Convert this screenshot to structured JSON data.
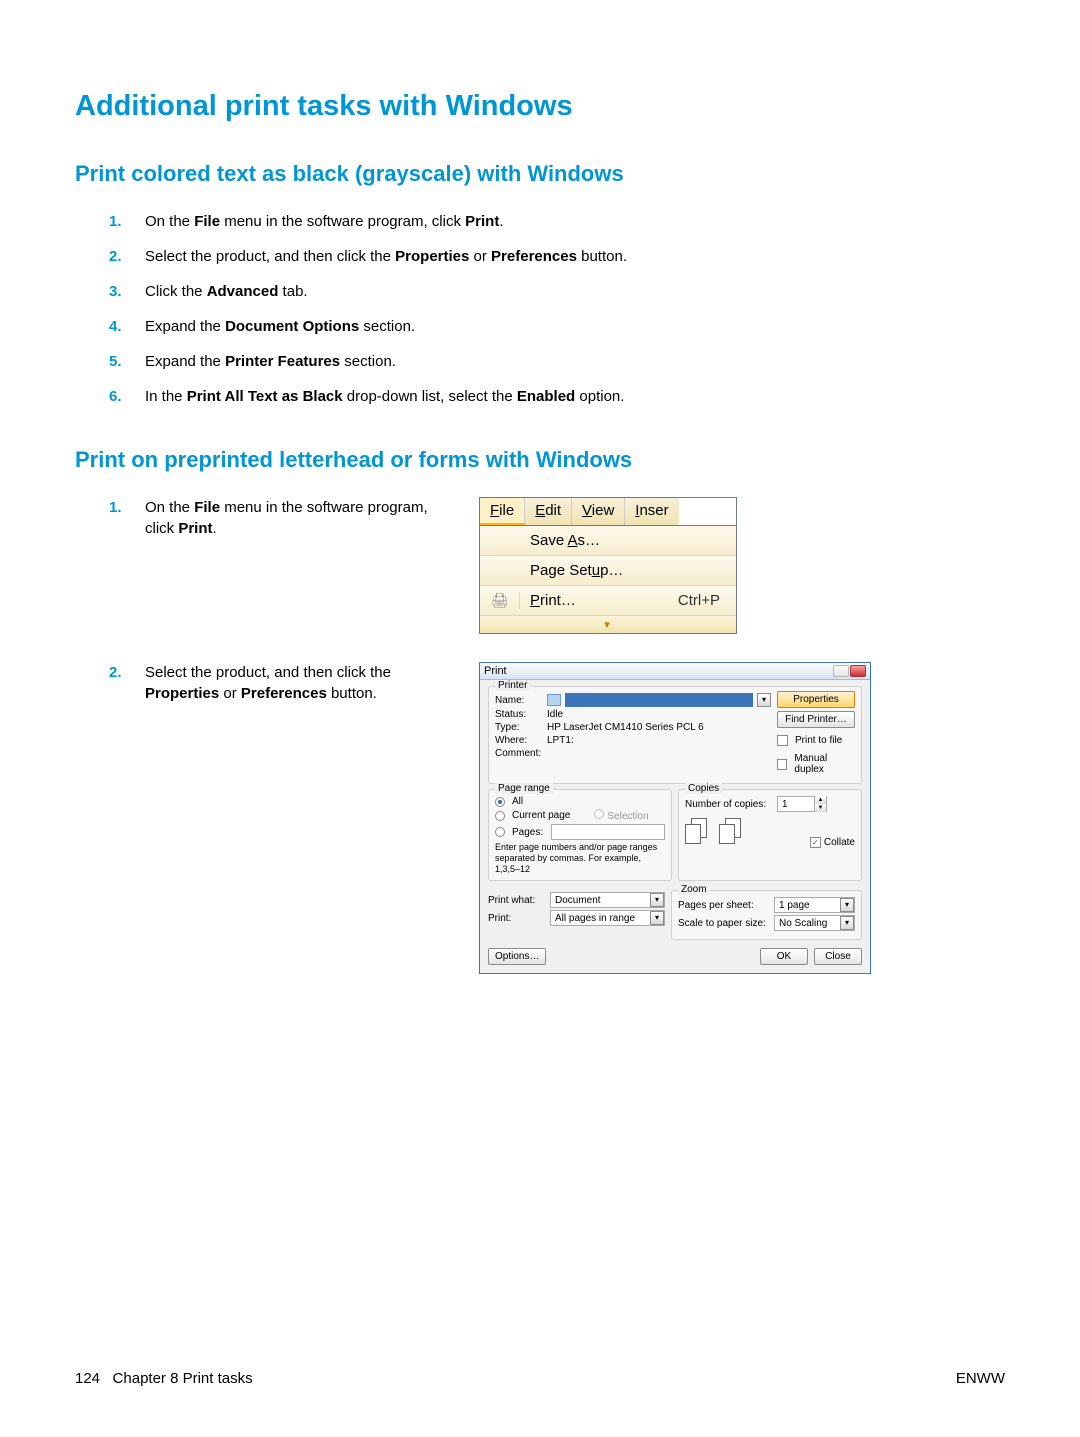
{
  "heading1": "Additional print tasks with Windows",
  "section1": {
    "title": "Print colored text as black (grayscale) with Windows",
    "steps": [
      {
        "pre": "On the ",
        "b1": "File",
        "mid": " menu in the software program, click ",
        "b2": "Print",
        "post": "."
      },
      {
        "pre": "Select the product, and then click the ",
        "b1": "Properties",
        "mid": " or ",
        "b2": "Preferences",
        "post": " button."
      },
      {
        "pre": "Click the ",
        "b1": "Advanced",
        "mid": "",
        "b2": "",
        "post": " tab."
      },
      {
        "pre": "Expand the ",
        "b1": "Document Options",
        "mid": "",
        "b2": "",
        "post": " section."
      },
      {
        "pre": "Expand the ",
        "b1": "Printer Features",
        "mid": "",
        "b2": "",
        "post": " section."
      },
      {
        "pre": "In the ",
        "b1": "Print All Text as Black",
        "mid": " drop-down list, select the ",
        "b2": "Enabled",
        "post": " option."
      }
    ]
  },
  "section2": {
    "title": "Print on preprinted letterhead or forms with Windows",
    "step1": {
      "pre": "On the ",
      "b1": "File",
      "mid": " menu in the software program, click ",
      "b2": "Print",
      "post": "."
    },
    "step2": {
      "pre": "Select the product, and then click the ",
      "b1": "Properties",
      "mid": " or ",
      "b2": "Preferences",
      "post": " button."
    }
  },
  "menu": {
    "file": "File",
    "edit": "Edit",
    "view": "View",
    "insert": "Inser",
    "items": {
      "saveas": "Save As…",
      "pagesetup": "Page Setup…",
      "print": "Print…",
      "print_sc": "Ctrl+P"
    }
  },
  "print_dialog": {
    "title": "Print",
    "printer_grp": "Printer",
    "name": "Name:",
    "status_lbl": "Status:",
    "status_val": "Idle",
    "type_lbl": "Type:",
    "type_val": "HP LaserJet CM1410 Series PCL 6",
    "where_lbl": "Where:",
    "where_val": "LPT1:",
    "comment_lbl": "Comment:",
    "properties_btn": "Properties",
    "find_btn": "Find Printer…",
    "print_to_file": "Print to file",
    "manual_duplex": "Manual duplex",
    "pagerange_grp": "Page range",
    "all": "All",
    "current": "Current page",
    "selection": "Selection",
    "pages": "Pages:",
    "pages_hint": "Enter page numbers and/or page ranges separated by commas. For example, 1,3,5–12",
    "copies_grp": "Copies",
    "numcopies": "Number of copies:",
    "numcopies_val": "1",
    "collate": "Collate",
    "printwhat_lbl": "Print what:",
    "printwhat_val": "Document",
    "print_lbl": "Print:",
    "print_val": "All pages in range",
    "zoom_grp": "Zoom",
    "pps": "Pages per sheet:",
    "pps_val": "1 page",
    "scale": "Scale to paper size:",
    "scale_val": "No Scaling",
    "options_btn": "Options…",
    "ok_btn": "OK",
    "close_btn": "Close"
  },
  "footer": {
    "page": "124",
    "chapter": "Chapter 8   Print tasks",
    "brand": "ENWW"
  }
}
